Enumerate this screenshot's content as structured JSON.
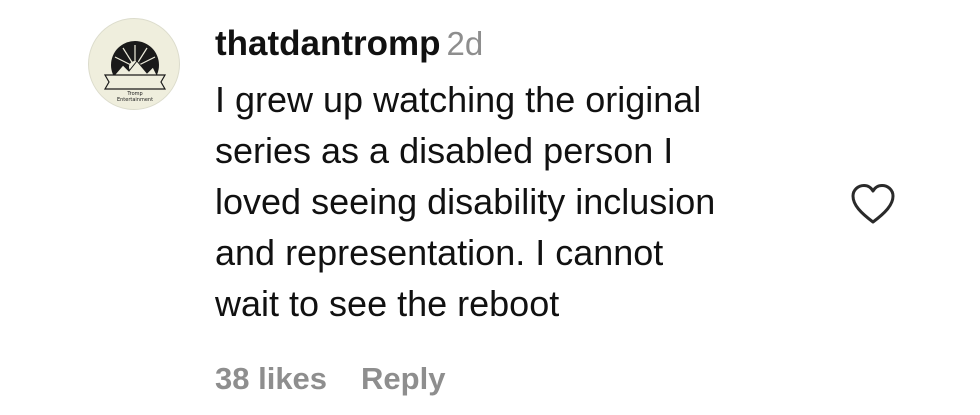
{
  "comment": {
    "username": "thatdantromp",
    "timestamp": "2d",
    "lines": [
      "I grew up watching the original",
      "series as a disabled person I",
      "loved seeing disability inclusion",
      "and representation. I cannot",
      "wait to see the reboot"
    ],
    "likes_label": "38 likes",
    "reply_label": "Reply",
    "avatar": {
      "logo_text_1": "Tromp",
      "logo_text_2": "Entertainment"
    },
    "like_icon": "heart-outline-icon"
  },
  "colors": {
    "text": "#111111",
    "muted": "#8e8e8e",
    "avatar_bg": "#efeedd",
    "logo": "#1a1a1a"
  }
}
